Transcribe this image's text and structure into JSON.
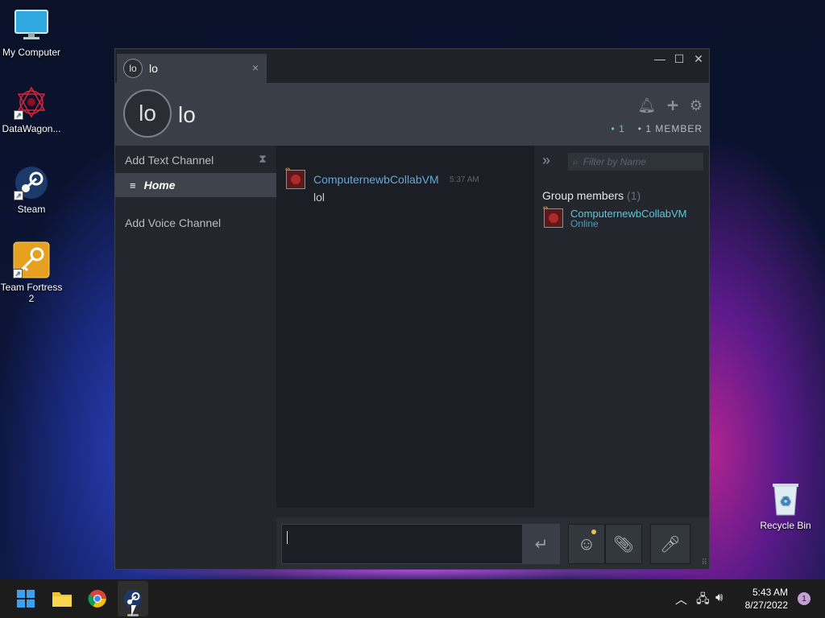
{
  "desktop": {
    "icons": [
      {
        "label": "My Computer"
      },
      {
        "label": "DataWagon..."
      },
      {
        "label": "Steam"
      },
      {
        "label": "Team Fortress 2"
      },
      {
        "label": "Recycle Bin"
      }
    ]
  },
  "window": {
    "tab": {
      "avatar_text": "lo",
      "title": "lo",
      "close": "×"
    },
    "controls": {
      "minimize": "—",
      "maximize": "☐",
      "close": "✕"
    },
    "header": {
      "avatar_text": "lo",
      "group_name": "lo",
      "online_count": "1",
      "member_count": "1 MEMBER"
    },
    "channels": {
      "add_text": "Add Text Channel",
      "home": "Home",
      "add_voice": "Add Voice Channel"
    },
    "chat": {
      "messages": [
        {
          "author": "ComputernewbCollabVM",
          "time": "5:37 AM",
          "text": "lol"
        }
      ]
    },
    "members": {
      "filter_placeholder": "Filter by Name",
      "group_title": "Group members",
      "group_count": "(1)",
      "list": [
        {
          "name": "ComputernewbCollabVM",
          "status": "Online"
        }
      ]
    }
  },
  "taskbar": {
    "time": "5:43 AM",
    "date": "8/27/2022",
    "notifications": "1"
  },
  "colors": {
    "accent_blue": "#57cbde",
    "name_blue": "#62a9d9",
    "panel": "#23262d",
    "header": "#3a3e46"
  }
}
